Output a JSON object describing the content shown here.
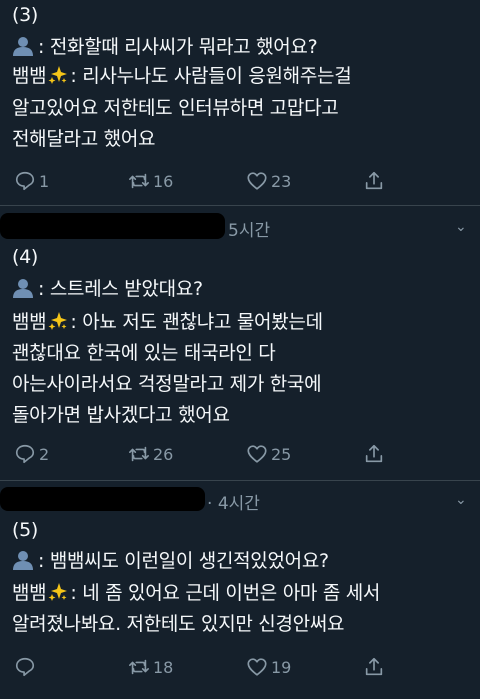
{
  "tweets": [
    {
      "number": "(3)",
      "question": ": 전화할때 리사씨가 뭐라고 했어요?",
      "speaker": "뱀뱀",
      "answer_lines": [
        ": 리사누나도 사람들이 응원해주는걸",
        "알고있어요 저한테도 인터뷰하면 고맙다고",
        "전해달라고 했어요"
      ],
      "replies": "1",
      "retweets": "16",
      "likes": "23"
    },
    {
      "number": "(4)",
      "question": ": 스트레스 받았대요?",
      "speaker": "뱀뱀",
      "answer_lines": [
        ": 아뇨 저도 괜찮냐고 물어봤는데",
        "괜찮대요 한국에 있는 태국라인 다",
        "아는사이라서요 걱정말라고 제가 한국에",
        "돌아가면 밥사겠다고 했어요"
      ],
      "replies": "2",
      "retweets": "26",
      "likes": "25"
    },
    {
      "number": "(5)",
      "question": ": 뱀뱀씨도 이런일이 생긴적있었어요?",
      "speaker": "뱀뱀",
      "answer_lines": [
        ": 네 좀 있어요 근데 이번은 아마 좀 세서",
        "알려졌나봐요. 저한테도 있지만 신경안써요"
      ],
      "replies": "",
      "retweets": "18",
      "likes": "19"
    }
  ],
  "headers": [
    {
      "time": "5시간"
    },
    {
      "time": "4시간"
    }
  ],
  "icons": {
    "avatar": "bust-in-silhouette-icon",
    "sparkle": "sparkles-icon"
  },
  "colors": {
    "background": "#15202b",
    "muted": "#8899a6",
    "text": "#f5f8fa",
    "avatar": "#6f8fb3",
    "sparkle": "#f5c518"
  }
}
